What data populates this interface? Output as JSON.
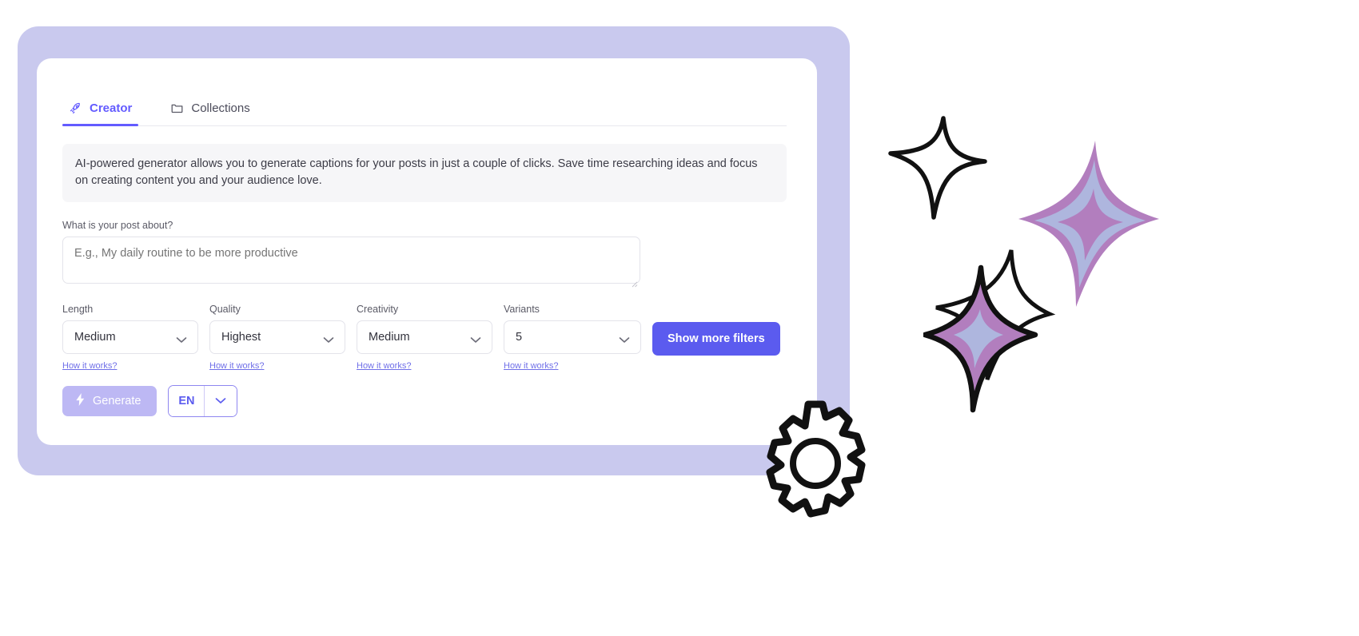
{
  "app": {
    "tabs": [
      {
        "label": "Creator",
        "icon": "rocket-icon",
        "active": true
      },
      {
        "label": "Collections",
        "icon": "folder-icon",
        "active": false
      }
    ],
    "info_banner": "AI-powered generator allows you to generate captions for your posts in just a couple of clicks. Save time researching ideas and focus on creating content you and your audience love.",
    "prompt": {
      "label": "What is your post about?",
      "placeholder": "E.g., My daily routine to be more productive",
      "value": ""
    },
    "selects": [
      {
        "label": "Length",
        "value": "Medium",
        "link": "How it works?"
      },
      {
        "label": "Quality",
        "value": "Highest",
        "link": "How it works?"
      },
      {
        "label": "Creativity",
        "value": "Medium",
        "link": "How it works?"
      },
      {
        "label": "Variants",
        "value": "5",
        "link": "How it works?"
      }
    ],
    "show_more_filters_label": "Show more filters",
    "generate_label": "Generate",
    "generate_icon": "lightning-bolt-icon",
    "language": {
      "code": "EN",
      "caret_icon": "chevron-down-icon"
    }
  },
  "colors": {
    "frame": "#C9C9EE",
    "accent": "#635BFF",
    "primary_button": "#5B5BEF",
    "disabled_button": "#BDB8F4",
    "link": "#6F6FE8",
    "banner_bg": "#F6F6F8",
    "sparkle_purple": "#B27EBE",
    "sparkle_blue": "#AEB6DE"
  },
  "decorations": [
    {
      "name": "sparkle-outline-top",
      "style": "outline"
    },
    {
      "name": "sparkle-filled-right",
      "style": "filled"
    },
    {
      "name": "sparkle-filled-bottom",
      "style": "filled"
    },
    {
      "name": "gear-doodle",
      "style": "outline"
    }
  ]
}
